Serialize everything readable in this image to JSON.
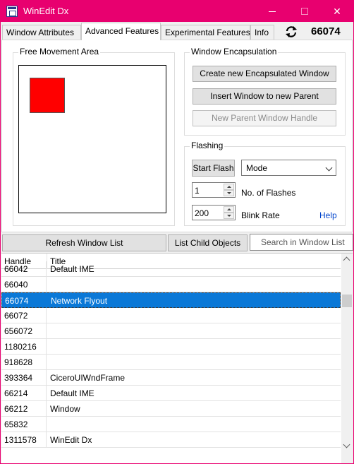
{
  "window": {
    "title": "WinEdit Dx",
    "accent_color": "#e8006f"
  },
  "tabs": [
    {
      "label": "Window Attributes"
    },
    {
      "label": "Advanced Features"
    },
    {
      "label": "Experimental Features"
    },
    {
      "label": "Info"
    }
  ],
  "active_tab": "Advanced Features",
  "current_handle": "66074",
  "free_movement": {
    "label": "Free Movement Area",
    "square_color": "#ff0000"
  },
  "encapsulation": {
    "label": "Window Encapsulation",
    "create_btn": "Create new Encapsulated Window",
    "insert_btn": "Insert Window to new Parent",
    "new_parent_btn": "New Parent Window Handle"
  },
  "flashing": {
    "label": "Flashing",
    "start_btn": "Start Flash",
    "mode_value": "Mode",
    "flashes_value": "1",
    "flashes_label": "No. of Flashes",
    "blink_value": "200",
    "blink_label": "Blink Rate",
    "help_link": "Help"
  },
  "bottom": {
    "refresh_btn": "Refresh Window List",
    "child_btn": "List Child Objects",
    "search_placeholder": "Search in Window List"
  },
  "table": {
    "columns": [
      "Handle",
      "Title"
    ],
    "rows": [
      {
        "handle": "66042",
        "title": "Default IME"
      },
      {
        "handle": "66040",
        "title": ""
      },
      {
        "handle": "66074",
        "title": "Network Flyout",
        "selected": true
      },
      {
        "handle": "66072",
        "title": ""
      },
      {
        "handle": "656072",
        "title": ""
      },
      {
        "handle": "1180216",
        "title": ""
      },
      {
        "handle": "918628",
        "title": ""
      },
      {
        "handle": "393364",
        "title": "CiceroUIWndFrame"
      },
      {
        "handle": "66214",
        "title": "Default IME"
      },
      {
        "handle": "66212",
        "title": "Window"
      },
      {
        "handle": "65832",
        "title": ""
      },
      {
        "handle": "1311578",
        "title": "WinEdit Dx"
      }
    ]
  }
}
